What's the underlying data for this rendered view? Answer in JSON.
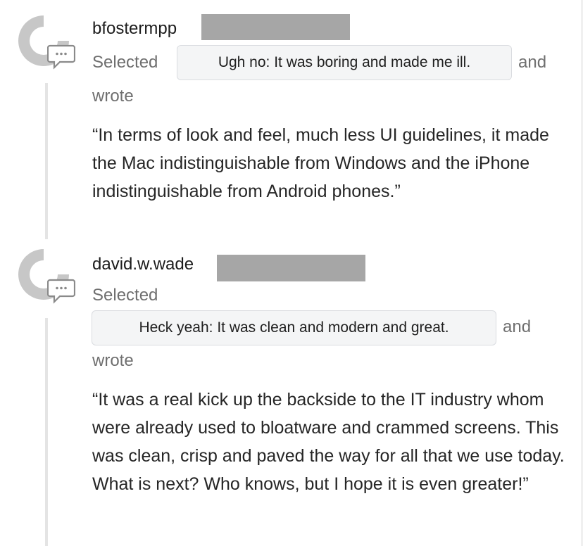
{
  "comments": [
    {
      "author": "bfostermpp",
      "selected_label": "Selected",
      "choice": "Ugh no: It was boring and made me ill.",
      "and_label": "and",
      "wrote_label": "wrote",
      "quote": "“In terms of look and feel, much less UI guidelines, it made the Mac indistinguishable from Windows and the iPhone indistinguishable from Android phones.”"
    },
    {
      "author": "david.w.wade",
      "selected_label": "Selected",
      "choice": "Heck yeah: It was clean and modern and great.",
      "and_label": "and",
      "wrote_label": "wrote",
      "quote": "“It was a real kick up the backside to the IT industry whom were already used to bloatware and crammed screens. This was clean, crisp and paved the way for all that we use today. What is next? Who knows, but I hope it is even greater!”"
    }
  ],
  "icons": {
    "avatar": "user-avatar-placeholder-icon",
    "comment": "speech-bubble-icon"
  },
  "colors": {
    "redaction": "#a6a6a6",
    "chip_bg": "#f4f5f6",
    "muted_text": "#6f6f6f"
  }
}
